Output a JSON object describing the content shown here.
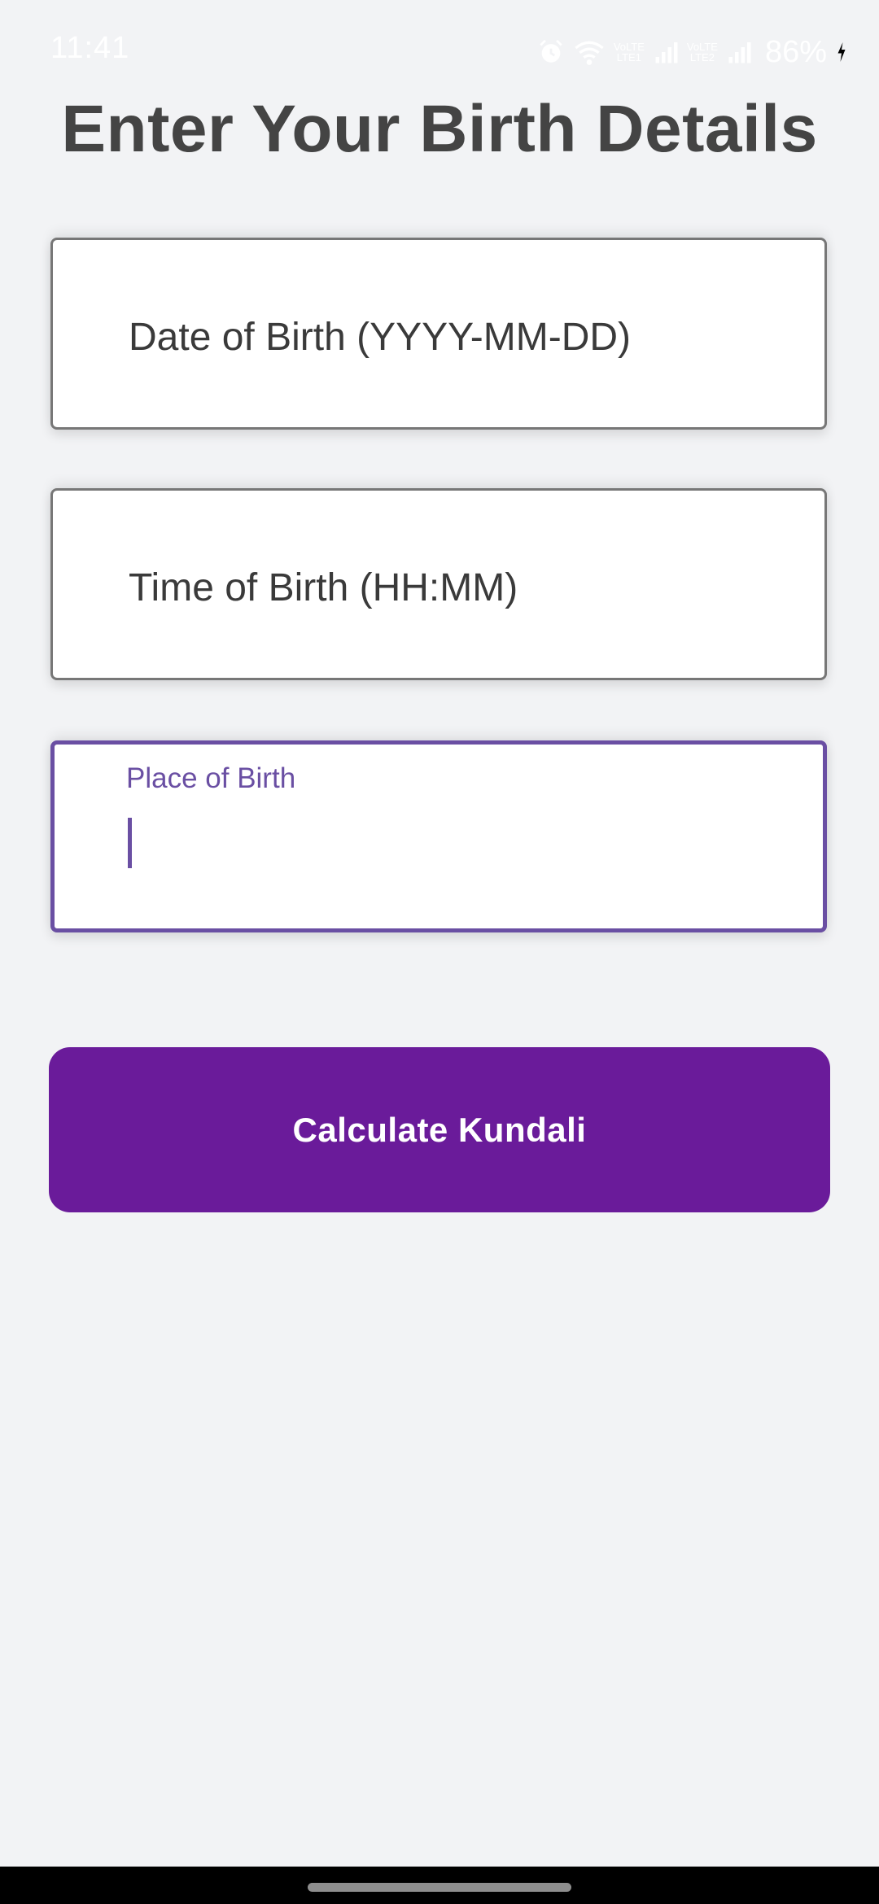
{
  "status_bar": {
    "time": "11:41",
    "battery": "86%",
    "sim1_label_top": "VoLTE",
    "sim1_label_bottom": "LTE1",
    "sim2_label_top": "VoLTE",
    "sim2_label_bottom": "LTE2",
    "icons": [
      "alarm-icon",
      "wifi-icon",
      "signal-icon",
      "signal-icon",
      "battery-charging-icon"
    ]
  },
  "page": {
    "title": "Enter Your Birth Details"
  },
  "form": {
    "date_of_birth": {
      "label": "Date of Birth (YYYY-MM-DD)",
      "value": ""
    },
    "time_of_birth": {
      "label": "Time of Birth (HH:MM)",
      "value": ""
    },
    "place_of_birth": {
      "label": "Place of Birth",
      "value": "",
      "focused": true
    }
  },
  "actions": {
    "calculate_label": "Calculate Kundali"
  },
  "colors": {
    "accent": "#6a4fa3",
    "button": "#6a1b9a",
    "background": "#f2f3f5",
    "title": "#444444"
  }
}
